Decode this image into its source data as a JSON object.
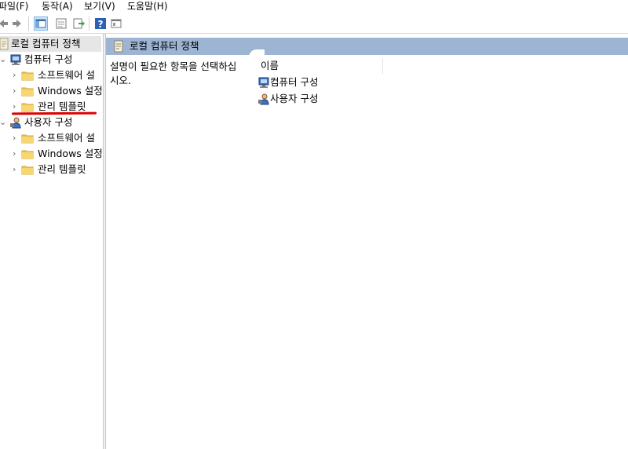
{
  "menu": {
    "file": "파일(F)",
    "action": "동작(A)",
    "view": "보기(V)",
    "help": "도움말(H)"
  },
  "tree": {
    "root": "로컬 컴퓨터 정책",
    "computer": {
      "label": "컴퓨터 구성",
      "children": [
        "소프트웨어 설",
        "Windows 설정",
        "관리 템플릿"
      ]
    },
    "user": {
      "label": "사용자 구성",
      "children": [
        "소프트웨어 설",
        "Windows 설정",
        "관리 템플릿"
      ]
    }
  },
  "content": {
    "header_title": "로컬 컴퓨터 정책",
    "description": "설명이 필요한 항목을 선택하십\n시오.",
    "column_name": "이름",
    "items": [
      "컴퓨터 구성",
      "사용자 구성"
    ]
  },
  "colors": {
    "header_bg": "#9db4d2",
    "annotation": "#e00000",
    "folder": "#f0c64a"
  },
  "icons": {
    "toolbar": [
      "back-icon",
      "forward-icon",
      "show-hide-tree-icon",
      "properties-icon",
      "export-list-icon",
      "help-icon",
      "extended-view-icon"
    ]
  }
}
